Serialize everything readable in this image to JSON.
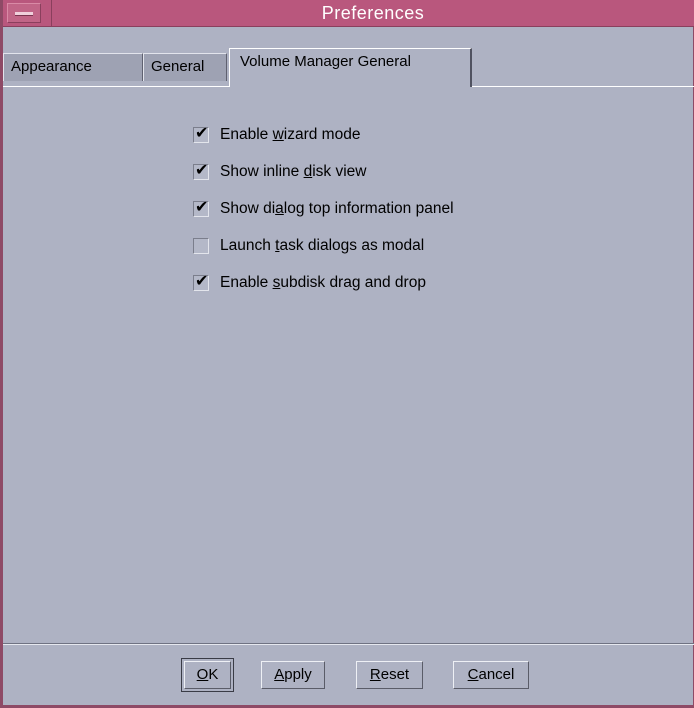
{
  "window": {
    "title": "Preferences",
    "menu_icon": "window-menu-icon"
  },
  "tabs": [
    {
      "label": "Appearance",
      "active": false
    },
    {
      "label": "General",
      "active": false
    },
    {
      "label": "Volume Manager General",
      "active": true
    }
  ],
  "options": [
    {
      "pre": "Enable ",
      "mnemonic": "w",
      "post": "izard mode",
      "checked": true
    },
    {
      "pre": "Show inline ",
      "mnemonic": "d",
      "post": "isk view",
      "checked": true
    },
    {
      "pre": "Show di",
      "mnemonic": "a",
      "post": "log top information panel",
      "checked": true
    },
    {
      "pre": "Launch ",
      "mnemonic": "t",
      "post": "ask dialogs as modal",
      "checked": false
    },
    {
      "pre": "Enable ",
      "mnemonic": "s",
      "post": "ubdisk drag and drop",
      "checked": true
    }
  ],
  "check_glyph": "✔",
  "buttons": {
    "ok": {
      "mnemonic": "O",
      "rest": "K"
    },
    "apply": {
      "mnemonic": "A",
      "rest": "pply"
    },
    "reset": {
      "mnemonic": "R",
      "rest": "eset"
    },
    "cancel": {
      "mnemonic": "C",
      "rest": "ancel"
    }
  },
  "colors": {
    "titlebar": "#b9577d",
    "background": "#aeb2c3"
  }
}
